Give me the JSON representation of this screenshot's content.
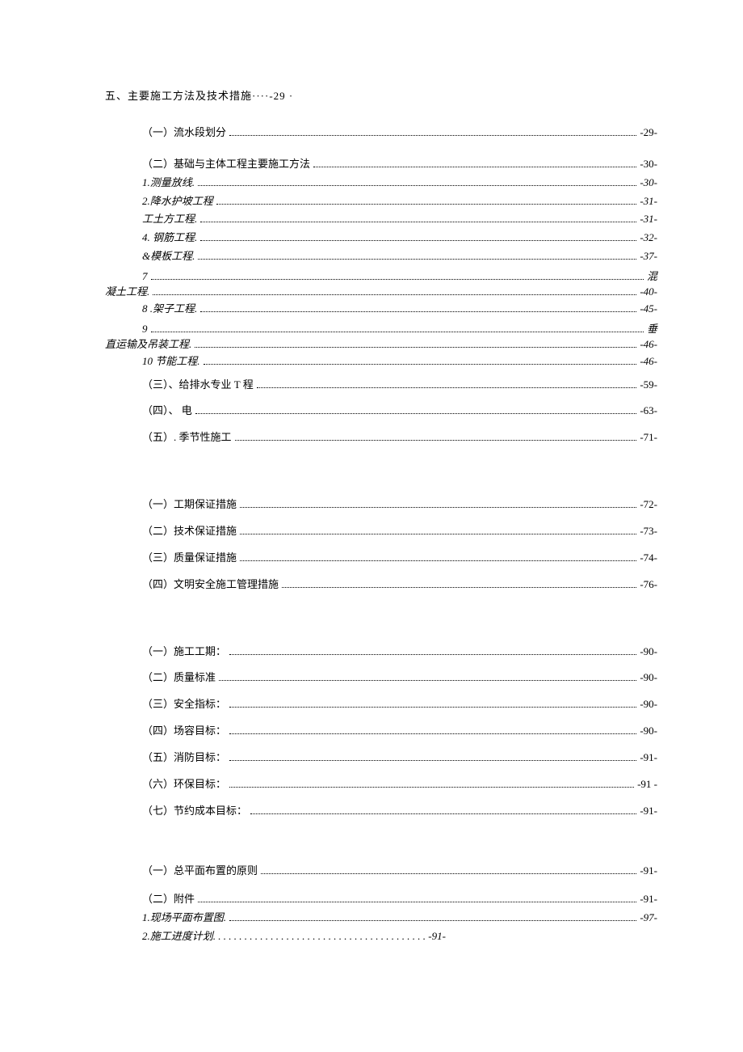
{
  "heading": "五、主要施工方法及技术措施····-29 ·",
  "group1": [
    {
      "label": "（一）流水段划分",
      "page": "-29-",
      "cls": "indent-1"
    }
  ],
  "group1b": [
    {
      "label": "（二）基础与主体工程主要施工方法",
      "page": "-30-",
      "cls": "indent-1"
    },
    {
      "label": "1.测量放线.",
      "page": "-30-",
      "cls": "indent-2 italic"
    },
    {
      "label": "2.降水护坡工程",
      "page": "-31-",
      "cls": "indent-2 italic"
    },
    {
      "label": "工土方工程.",
      "page": "-31-",
      "cls": "indent-2 italic"
    },
    {
      "label": "4. 钢筋工程.",
      "page": "-32-",
      "cls": "indent-2 italic"
    },
    {
      "label": "&模板工程.",
      "page": "-37-",
      "cls": "indent-2 italic"
    }
  ],
  "wrap7": {
    "pre": "7",
    "right": "混",
    "bottomLabel": "凝土工程.",
    "page": "-40-"
  },
  "l8": {
    "label": "8   .架子工程.",
    "page": "-45-",
    "cls": "indent-2 italic"
  },
  "wrap9": {
    "pre": "9",
    "right": "垂",
    "bottomLabel": "直运输及吊装工程.",
    "page": "-46-"
  },
  "l10": {
    "label": "10       节能工程.",
    "page": "-46-",
    "cls": "indent-2 italic"
  },
  "group1c": [
    {
      "label": "（三）、给排水专业 T 程",
      "page": "-59-",
      "cls": "indent-1"
    },
    {
      "label": "（四）、 电",
      "page": "-63-",
      "cls": "indent-1"
    },
    {
      "label": "（五）. 季节性施工",
      "page": "-71-",
      "cls": "indent-1"
    }
  ],
  "group2": [
    {
      "label": "（一）工期保证措施",
      "page": "-72-",
      "cls": "indent-1"
    },
    {
      "label": "（二）技术保证措施",
      "page": "-73-",
      "cls": "indent-1"
    },
    {
      "label": "（三）质量保证措施",
      "page": "-74-",
      "cls": "indent-1"
    },
    {
      "label": "（四）文明安全施工管理措施",
      "page": "-76-",
      "cls": "indent-1"
    }
  ],
  "group3": [
    {
      "label": "（一）施工工期：",
      "page": "-90-",
      "cls": "indent-1"
    },
    {
      "label": "（二）质量标准",
      "page": "-90-",
      "cls": "indent-1"
    },
    {
      "label": "（三）安全指标：",
      "page": "-90-",
      "cls": "indent-1"
    },
    {
      "label": "（四）场容目标：",
      "page": "-90-",
      "cls": "indent-1"
    },
    {
      "label": "（五）消防目标：",
      "page": "-91-",
      "cls": "indent-1"
    },
    {
      "label": "（六）环保目标：",
      "page": "-91   -",
      "cls": "indent-1"
    },
    {
      "label": "（七）节约成本目标：",
      "page": "-91-",
      "cls": "indent-1"
    }
  ],
  "group4": [
    {
      "label": "（一）总平面布置的原则",
      "page": "-91-",
      "cls": "indent-1"
    }
  ],
  "group4b": [
    {
      "label": "（二）附件",
      "page": "-91-",
      "cls": "indent-1"
    },
    {
      "label": "1.现场平面布置图.",
      "page": "-97-",
      "cls": "indent-2 italic"
    }
  ],
  "lastNoDots": {
    "label": "2.施工进度计划.  .  .  .  .  .  .  .  .  .  .  .  .  .  .  .  .  .  .  .  .  .  .  .  .  .  .  .  .  .  .  .  .  .  .  .  .  .  .  .  . -91-",
    "cls": "indent-2 italic"
  }
}
